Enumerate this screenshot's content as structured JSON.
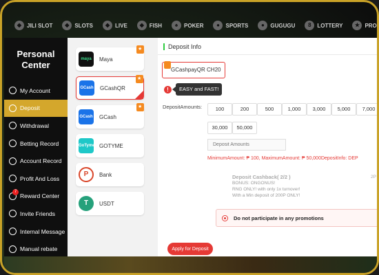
{
  "nav": {
    "items": [
      {
        "label": "JILI SLOT",
        "icon": "jili-icon"
      },
      {
        "label": "SLOTS",
        "icon": "slots-icon"
      },
      {
        "label": "LIVE",
        "icon": "live-icon"
      },
      {
        "label": "FISH",
        "icon": "fish-icon"
      },
      {
        "label": "POKER",
        "icon": "poker-icon"
      },
      {
        "label": "SPORTS",
        "icon": "sports-icon"
      },
      {
        "label": "GUGUGU",
        "icon": "gugugu-icon"
      },
      {
        "label": "LOTTERY",
        "icon": "lottery-icon"
      },
      {
        "label": "PROMOTION",
        "icon": "promotion-icon"
      }
    ]
  },
  "sidebar": {
    "title_line1": "Personal",
    "title_line2": "Center",
    "active_color": "#d4a72c",
    "reward_badge": "7",
    "items": [
      {
        "label": "My Account",
        "icon": "account-icon"
      },
      {
        "label": "Deposit",
        "icon": "deposit-icon"
      },
      {
        "label": "Withdrawal",
        "icon": "withdrawal-icon"
      },
      {
        "label": "Betting Record",
        "icon": "betting-record-icon"
      },
      {
        "label": "Account Record",
        "icon": "account-record-icon"
      },
      {
        "label": "Profit And Loss",
        "icon": "profit-loss-icon"
      },
      {
        "label": "Reward Center",
        "icon": "reward-icon"
      },
      {
        "label": "Invite Friends",
        "icon": "invite-icon"
      },
      {
        "label": "Internal Message",
        "icon": "message-icon"
      },
      {
        "label": "Manual rebate",
        "icon": "rebate-icon"
      }
    ]
  },
  "methods": {
    "items": [
      {
        "label": "Maya",
        "logo_text": "maya",
        "logo_color": "#111111"
      },
      {
        "label": "GCashQR",
        "logo_text": "GCash",
        "logo_color": "#1a73e8"
      },
      {
        "label": "GCash",
        "logo_text": "GCash",
        "logo_color": "#1a73e8"
      },
      {
        "label": "GOTYME",
        "logo_text": "GoTyme",
        "logo_color": "#1ec8c8"
      },
      {
        "label": "Bank",
        "logo_text": "P",
        "logo_color": "#d9462a"
      },
      {
        "label": "USDT",
        "logo_text": "T",
        "logo_color": "#26a17b"
      }
    ]
  },
  "deposit": {
    "section_title": "Deposit Info",
    "channel": "GCashpayQR CH20",
    "tooltip": "EASY and FAST!",
    "amounts_label": "DepositAmounts:",
    "amounts": [
      "100",
      "200",
      "500",
      "1,000",
      "3,000",
      "5,000",
      "7,000",
      "30,000",
      "50,000"
    ],
    "amount_placeholder": "Deposit Amounts",
    "limits_text": "MinimumAmount: ₱ 100, MaximumAmount: ₱ 50,000DepositInfo:  DEP",
    "promo_title": "Deposit Cashback( 2/2 )",
    "promo_line1": "BONUS: ONGONUS!",
    "promo_line2": "RNG ONLY! with only 1x turnover!",
    "promo_line3": "With a Min deposit of 200P ONLY!",
    "promo_date": "2P",
    "no_promo_label": "Do not participate in any promotions",
    "apply_label": "Apply for Deposit",
    "accent_color": "#e53935"
  }
}
